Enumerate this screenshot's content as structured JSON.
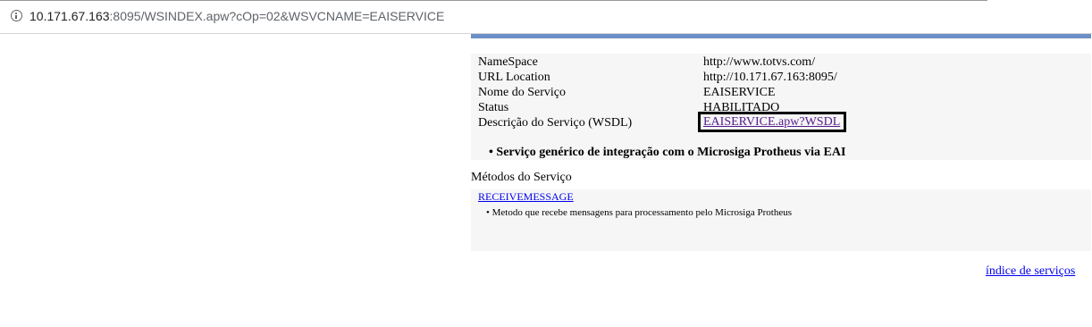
{
  "browser": {
    "url_host": "10.171.67.163",
    "url_rest": ":8095/WSINDEX.apw?cOp=02&WSVCNAME=EAISERVICE"
  },
  "properties": [
    {
      "label": "NameSpace",
      "value": "http://www.totvs.com/"
    },
    {
      "label": "URL Location",
      "value": "http://10.171.67.163:8095/"
    },
    {
      "label": "Nome do Serviço",
      "value": "EAISERVICE"
    },
    {
      "label": "Status",
      "value": "HABILITADO"
    },
    {
      "label": "Descrição do Serviço (WSDL)",
      "value": "EAISERVICE.apw?WSDL"
    }
  ],
  "service_description": "• Serviço genérico de integração com o Microsiga Protheus via EAI",
  "methods": {
    "title": "Métodos do Serviço",
    "items": [
      {
        "name": "RECEIVEMESSAGE",
        "description": "• Metodo que recebe mensagens para processamento pelo Microsiga Protheus"
      }
    ]
  },
  "footer": {
    "index_link": "índice de serviços"
  },
  "colors": {
    "header_bar": "#6b8fc6",
    "panel_bg": "#f6f6f6",
    "link": "#0000ee",
    "visited_link": "#551a8b"
  }
}
